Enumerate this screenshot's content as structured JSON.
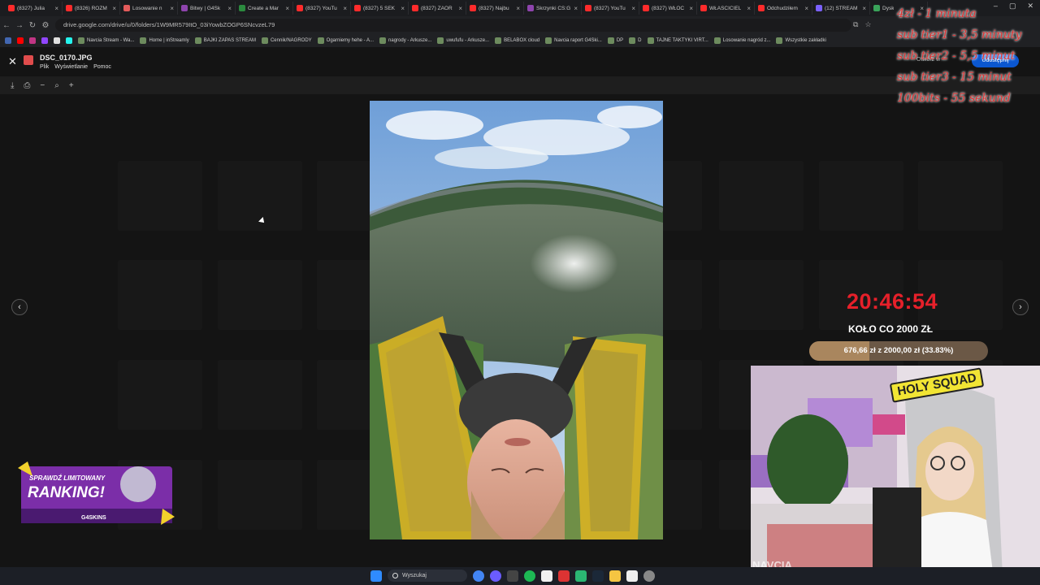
{
  "browser": {
    "tabs": [
      {
        "label": "(8327) Julia",
        "color": "#ff2b2b"
      },
      {
        "label": "(8326) ROZM",
        "color": "#ff2b2b"
      },
      {
        "label": "Losowanie n",
        "color": "#e35b5b"
      },
      {
        "label": "Bitwy | G4Sk",
        "color": "#8e44ad"
      },
      {
        "label": "Create a Mar",
        "color": "#2b8a3e"
      },
      {
        "label": "(8327) YouTu",
        "color": "#ff2b2b"
      },
      {
        "label": "(8327) 5 SEK",
        "color": "#ff2b2b"
      },
      {
        "label": "(8327) ZAOR",
        "color": "#ff2b2b"
      },
      {
        "label": "(8327) Najbu",
        "color": "#ff2b2b"
      },
      {
        "label": "Skrzynki CS:G",
        "color": "#8e44ad"
      },
      {
        "label": "(8327) YouTu",
        "color": "#ff2b2b"
      },
      {
        "label": "(8327) WŁOC",
        "color": "#ff2b2b"
      },
      {
        "label": "WŁAŚCICIEL",
        "color": "#ff2b2b"
      },
      {
        "label": "Odchudziłem",
        "color": "#ff2b2b"
      },
      {
        "label": "(12) STREAM",
        "color": "#7b61ff"
      },
      {
        "label": "Dysk",
        "color": "#3aa35a"
      }
    ],
    "url": "drive.google.com/drive/u/0/folders/1W9MR579ItO_03iYowbZOGP6SNcvzeL79",
    "bookmarks": [
      "Navcia Stream - Wa...",
      "Home | inStreamly",
      "BAJKI ZAPAS STREAM",
      "Cennik/NAGRODY",
      "Ogarniemy hehe - A...",
      "nagrody - Arkusze...",
      "uwufufu - Arkusze...",
      "BELABOX cloud",
      "Navcia raport G4Ski...",
      "DP",
      "D",
      "TAJNE TAKTYKI VIRT...",
      "Losowanie nagród z...",
      "Wszystkie zakładki"
    ]
  },
  "viewer": {
    "file_name": "DSC_0170.JPG",
    "menu": [
      "Plik",
      "Wyświetlanie",
      "Pomoc"
    ],
    "open_with": "Otwórz w",
    "share": "Udostępnij"
  },
  "overlay": {
    "rates": [
      "4zł - 1 minuta",
      "sub tier1 - 3,5 minuty",
      "sub tier2 - 5,5 minut",
      "sub tier3 - 15 minut",
      "100bits - 55 sekund"
    ],
    "timer": "20:46:54",
    "wheel_title": "KOŁO CO 2000 ZŁ",
    "progress_label": "676,66 zł z 2000,00 zł (33.83%)",
    "progress_percent": 33.83,
    "promo": {
      "line1": "SPRAWDŹ LIMITOWANY",
      "line2": "RANKING!",
      "brand": "G4SKINS"
    },
    "logo": "HOLY SQUAD",
    "webcam_caption": "NAVCIA"
  },
  "taskbar": {
    "search_placeholder": "Wyszukaj"
  }
}
